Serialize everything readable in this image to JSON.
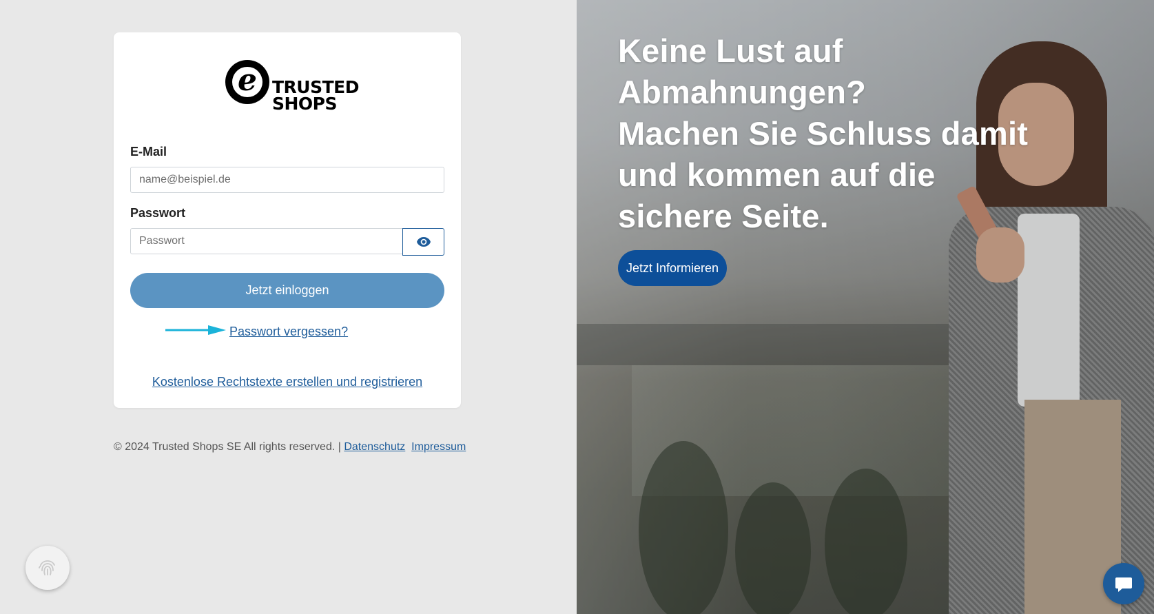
{
  "login": {
    "logo_line1": "TRUSTED",
    "logo_line2": "SHOPS",
    "logo_mark": "e",
    "email_label": "E-Mail",
    "email_placeholder": "name@beispiel.de",
    "email_value": "",
    "password_label": "Passwort",
    "password_placeholder": "Passwort",
    "password_value": "",
    "login_button": "Jetzt einloggen",
    "forgot_link": "Passwort vergessen?",
    "register_link": "Kostenlose Rechtstexte erstellen und registrieren",
    "show_password_icon": "eye-icon"
  },
  "footer": {
    "copyright": "© 2024 Trusted Shops SE All rights reserved. |",
    "privacy_link": "Datenschutz",
    "imprint_link": "Impressum"
  },
  "hero": {
    "headline_line1": "Keine Lust auf",
    "headline_line2": "Abmahnungen?",
    "headline_line3": "Machen Sie Schluss damit",
    "headline_line4": "und kommen auf die",
    "headline_line5": "sichere Seite.",
    "cta_button": "Jetzt Informieren"
  },
  "widgets": {
    "fingerprint_icon": "fingerprint-icon",
    "chat_icon": "chat-bubble-icon"
  },
  "colors": {
    "accent": "#1e5c9a",
    "login_button": "#5b94c2",
    "cta_button": "#0d4f99",
    "arrow": "#1bb3d9"
  }
}
